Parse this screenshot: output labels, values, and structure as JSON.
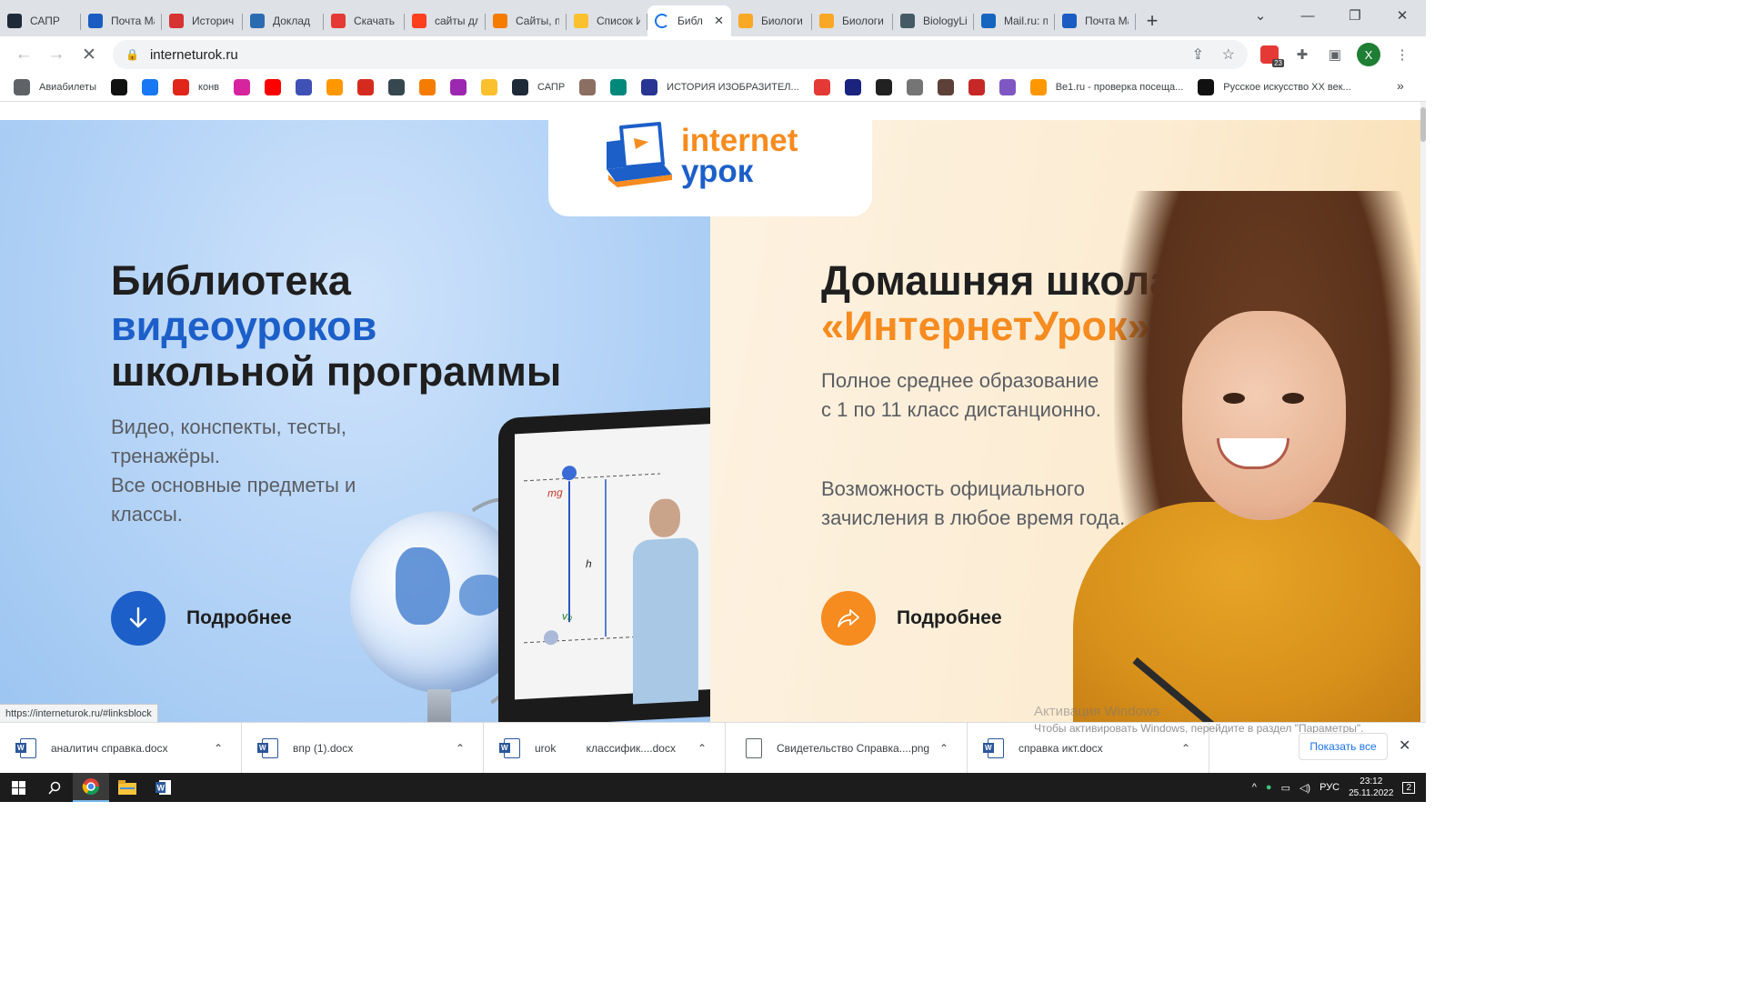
{
  "browser": {
    "tabs": [
      {
        "title": "САПР",
        "icon": "react-icon",
        "color": "#1e2a38"
      },
      {
        "title": "Почта Ma",
        "icon": "mail-icon",
        "color": "#1a5cc2"
      },
      {
        "title": "Историч",
        "icon": "flower-icon",
        "color": "#d63333"
      },
      {
        "title": "Доклад",
        "icon": "book-icon",
        "color": "#2b6cb0"
      },
      {
        "title": "Скачать",
        "icon": "heart-icon",
        "color": "#e53935"
      },
      {
        "title": "сайты дл",
        "icon": "yandex-icon",
        "color": "#fc3f1d"
      },
      {
        "title": "Сайты, п",
        "icon": "plane-icon",
        "color": "#f57c00"
      },
      {
        "title": "Список И",
        "icon": "pencil-icon",
        "color": "#fbc02d"
      },
      {
        "title": "Библ",
        "icon": "loading-icon",
        "color": "#ffffff",
        "active": true
      },
      {
        "title": "Биологи",
        "icon": "play-icon",
        "color": "#f9a825"
      },
      {
        "title": "Биологи",
        "icon": "play-icon",
        "color": "#f9a825"
      },
      {
        "title": "BiologyLi",
        "icon": "bio-icon",
        "color": "#455a64"
      },
      {
        "title": "Mail.ru: п",
        "icon": "at-icon",
        "color": "#1565c0"
      },
      {
        "title": "Почта Ma",
        "icon": "mail-icon",
        "color": "#1a5cc2"
      }
    ],
    "url": "interneturok.ru",
    "profile_initial": "X",
    "adblock_count": "23",
    "bookmarks": [
      {
        "label": "Авиабилеты",
        "icon": "globe-icon",
        "color": "#5f6368"
      },
      {
        "label": "",
        "icon": "star-icon",
        "color": "#111111"
      },
      {
        "label": "",
        "icon": "facebook-icon",
        "color": "#1877f2"
      },
      {
        "label": "конв",
        "icon": "adobe-icon",
        "color": "#e1251b"
      },
      {
        "label": "",
        "icon": "instagram-icon",
        "color": "#d6249f"
      },
      {
        "label": "",
        "icon": "youtube-icon",
        "color": "#ff0000"
      },
      {
        "label": "",
        "icon": "emblem-icon",
        "color": "#3f51b5"
      },
      {
        "label": "",
        "icon": "at-icon",
        "color": "#ff9800"
      },
      {
        "label": "",
        "icon": "flag-icon",
        "color": "#d52b1e"
      },
      {
        "label": "",
        "icon": "planet-icon",
        "color": "#37474f"
      },
      {
        "label": "",
        "icon": "plane-icon",
        "color": "#f57c00"
      },
      {
        "label": "",
        "icon": "blob-icon",
        "color": "#9c27b0"
      },
      {
        "label": "",
        "icon": "hand-icon",
        "color": "#fbc02d"
      },
      {
        "label": "САПР",
        "icon": "react-icon",
        "color": "#1e2a38"
      },
      {
        "label": "",
        "icon": "seal-icon",
        "color": "#8d6e63"
      },
      {
        "label": "",
        "icon": "book-icon",
        "color": "#00897b"
      },
      {
        "label": "ИСТОРИЯ ИЗОБРАЗИТЕЛ...",
        "icon": "museum-icon",
        "color": "#283593"
      },
      {
        "label": "",
        "icon": "grid-icon",
        "color": "#e53935"
      },
      {
        "label": "",
        "icon": "v-icon",
        "color": "#1a237e"
      },
      {
        "label": "",
        "icon": "circle-icon",
        "color": "#212121"
      },
      {
        "label": "",
        "icon": "share-icon",
        "color": "#757575"
      },
      {
        "label": "",
        "icon": "portrait-icon",
        "color": "#5d4037"
      },
      {
        "label": "",
        "icon": "rose-icon",
        "color": "#c62828"
      },
      {
        "label": "",
        "icon": "r-icon",
        "color": "#7e57c2"
      },
      {
        "label": "Be1.ru - проверка посеща...",
        "icon": "be1-icon",
        "color": "#ff9800"
      },
      {
        "label": "Русское искусство XX век...",
        "icon": "a-icon",
        "color": "#111111"
      }
    ],
    "bookmarks_more": "»",
    "status_url": "https://interneturok.ru/#linksblock"
  },
  "page": {
    "logo": {
      "line1": "internet",
      "line2": "урок"
    },
    "left": {
      "title_line1": "Библиотека",
      "title_accent": "видеоуроков",
      "title_line3": "школьной программы",
      "desc_line1": "Видео, конспекты, тесты,",
      "desc_line2": "тренажёры.",
      "desc_line3": "Все основные предметы и",
      "desc_line4": "классы.",
      "cta": "Подробнее",
      "board_label_mg": "mg",
      "board_label_h": "h",
      "board_label_v": "v₀"
    },
    "right": {
      "title_line1": "Домашняя школа",
      "title_accent": "«ИнтернетУрок»",
      "desc1_line1": "Полное среднее образование",
      "desc1_line2": "с 1 по 11 класс дистанционно.",
      "desc2_line1": "Возможность официального",
      "desc2_line2": "зачисления в любое время года.",
      "cta": "Подробнее"
    },
    "colors": {
      "blue": "#1c5fc9",
      "orange": "#f68b1f"
    }
  },
  "windows_watermark": {
    "title": "Активация Windows",
    "text": "Чтобы активировать Windows, перейдите в раздел \"Параметры\"."
  },
  "downloads": {
    "items": [
      {
        "name": "аналитич справка.docx",
        "type": "word"
      },
      {
        "name": "впр (1).docx",
        "type": "word"
      },
      {
        "name": "urok          классифик....docx",
        "type": "word"
      },
      {
        "name": "Свидетельство Справка....png",
        "type": "image"
      },
      {
        "name": "справка икт.docx",
        "type": "word"
      }
    ],
    "show_all": "Показать все"
  },
  "taskbar": {
    "language": "РУС",
    "time": "23:12",
    "date": "25.11.2022",
    "notifications": "2"
  }
}
